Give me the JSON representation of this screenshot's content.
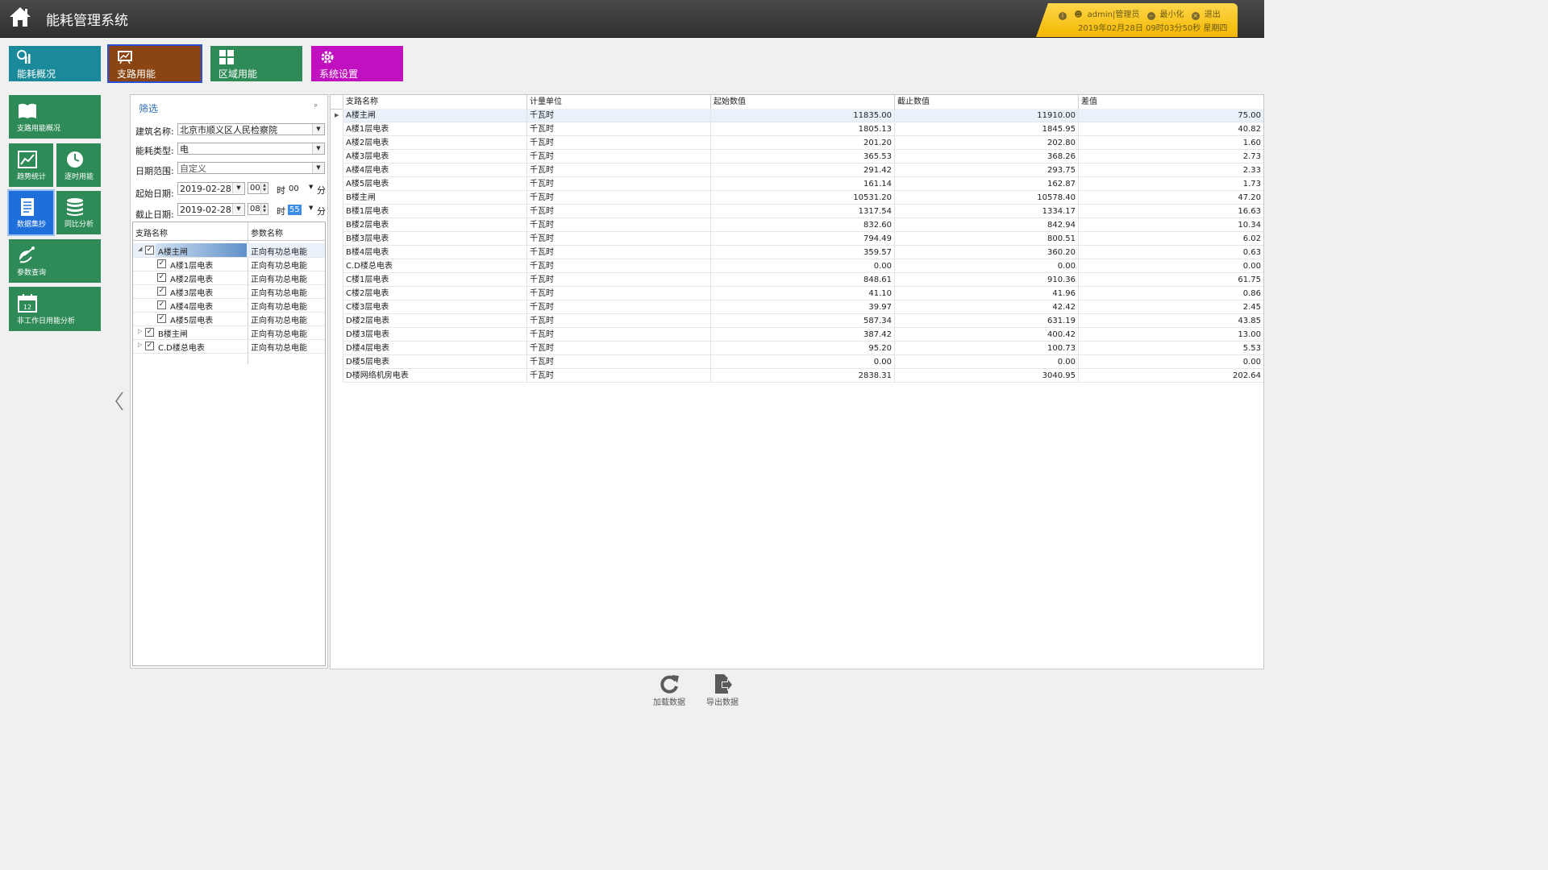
{
  "header": {
    "title": "能耗管理系统",
    "user_label": "admin|管理员",
    "minimize_label": "最小化",
    "logout_label": "退出",
    "datetime": "2019年02月28日  09时03分50秒  星期四"
  },
  "top_tiles": [
    {
      "label": "能耗概况",
      "icon": "chart-icon",
      "color": "#1a8a9a"
    },
    {
      "label": "支路用能",
      "icon": "presentation-icon",
      "color": "#8b4513"
    },
    {
      "label": "区域用能",
      "icon": "grid-icon",
      "color": "#2e8b57"
    },
    {
      "label": "系统设置",
      "icon": "gear-icon",
      "color": "#c010c0"
    }
  ],
  "side_tiles": [
    {
      "label": "支路用能概况",
      "icon": "book-icon"
    },
    {
      "label": "趋势统计",
      "icon": "trend-icon"
    },
    {
      "label": "逐时用能",
      "icon": "clock-icon"
    },
    {
      "label": "数据集抄",
      "icon": "document-icon"
    },
    {
      "label": "同比分析",
      "icon": "database-icon"
    },
    {
      "label": "参数查询",
      "icon": "satellite-icon"
    },
    {
      "label": "非工作日用能分析",
      "icon": "calendar-icon",
      "calendar_day": "12"
    }
  ],
  "filter": {
    "title": "筛选",
    "pin": "ᵖ",
    "building_label": "建筑名称:",
    "building_value": "北京市顺义区人民检察院",
    "energy_label": "能耗类型:",
    "energy_value": "电",
    "range_label": "日期范围:",
    "range_value": "自定义",
    "start_label": "起始日期:",
    "start_date": "2019-02-28",
    "start_hour": "00",
    "start_minute": "00",
    "end_label": "截止日期:",
    "end_date": "2019-02-28",
    "end_hour": "08",
    "end_minute": "55",
    "hour_unit": "时",
    "minute_unit": "分"
  },
  "tree": {
    "headers": [
      "支路名称",
      "参数名称"
    ],
    "rows": [
      {
        "name": "A楼主闸",
        "param": "正向有功总电能",
        "level": 0,
        "expander": "◢"
      },
      {
        "name": "A楼1层电表",
        "param": "正向有功总电能",
        "level": 1,
        "expander": ""
      },
      {
        "name": "A楼2层电表",
        "param": "正向有功总电能",
        "level": 1,
        "expander": ""
      },
      {
        "name": "A楼3层电表",
        "param": "正向有功总电能",
        "level": 1,
        "expander": ""
      },
      {
        "name": "A楼4层电表",
        "param": "正向有功总电能",
        "level": 1,
        "expander": ""
      },
      {
        "name": "A楼5层电表",
        "param": "正向有功总电能",
        "level": 1,
        "expander": ""
      },
      {
        "name": "B楼主闸",
        "param": "正向有功总电能",
        "level": 0,
        "expander": "▷"
      },
      {
        "name": "C.D楼总电表",
        "param": "正向有功总电能",
        "level": 0,
        "expander": "▷"
      }
    ]
  },
  "grid": {
    "headers": [
      "支路名称",
      "计量单位",
      "起始数值",
      "截止数值",
      "差值"
    ],
    "row_indicator": "▶",
    "rows": [
      [
        "A楼主闸",
        "千瓦时",
        "11835.00",
        "11910.00",
        "75.00"
      ],
      [
        "A楼1层电表",
        "千瓦时",
        "1805.13",
        "1845.95",
        "40.82"
      ],
      [
        "A楼2层电表",
        "千瓦时",
        "201.20",
        "202.80",
        "1.60"
      ],
      [
        "A楼3层电表",
        "千瓦时",
        "365.53",
        "368.26",
        "2.73"
      ],
      [
        "A楼4层电表",
        "千瓦时",
        "291.42",
        "293.75",
        "2.33"
      ],
      [
        "A楼5层电表",
        "千瓦时",
        "161.14",
        "162.87",
        "1.73"
      ],
      [
        "B楼主闸",
        "千瓦时",
        "10531.20",
        "10578.40",
        "47.20"
      ],
      [
        "B楼1层电表",
        "千瓦时",
        "1317.54",
        "1334.17",
        "16.63"
      ],
      [
        "B楼2层电表",
        "千瓦时",
        "832.60",
        "842.94",
        "10.34"
      ],
      [
        "B楼3层电表",
        "千瓦时",
        "794.49",
        "800.51",
        "6.02"
      ],
      [
        "B楼4层电表",
        "千瓦时",
        "359.57",
        "360.20",
        "0.63"
      ],
      [
        "C.D楼总电表",
        "千瓦时",
        "0.00",
        "0.00",
        "0.00"
      ],
      [
        "C楼1层电表",
        "千瓦时",
        "848.61",
        "910.36",
        "61.75"
      ],
      [
        "C楼2层电表",
        "千瓦时",
        "41.10",
        "41.96",
        "0.86"
      ],
      [
        "C楼3层电表",
        "千瓦时",
        "39.97",
        "42.42",
        "2.45"
      ],
      [
        "D楼2层电表",
        "千瓦时",
        "587.34",
        "631.19",
        "43.85"
      ],
      [
        "D楼3层电表",
        "千瓦时",
        "387.42",
        "400.42",
        "13.00"
      ],
      [
        "D楼4层电表",
        "千瓦时",
        "95.20",
        "100.73",
        "5.53"
      ],
      [
        "D楼5层电表",
        "千瓦时",
        "0.00",
        "0.00",
        "0.00"
      ],
      [
        "D楼网络机房电表",
        "千瓦时",
        "2838.31",
        "3040.95",
        "202.64"
      ]
    ]
  },
  "actions": {
    "load_label": "加载数据",
    "export_label": "导出数据"
  }
}
